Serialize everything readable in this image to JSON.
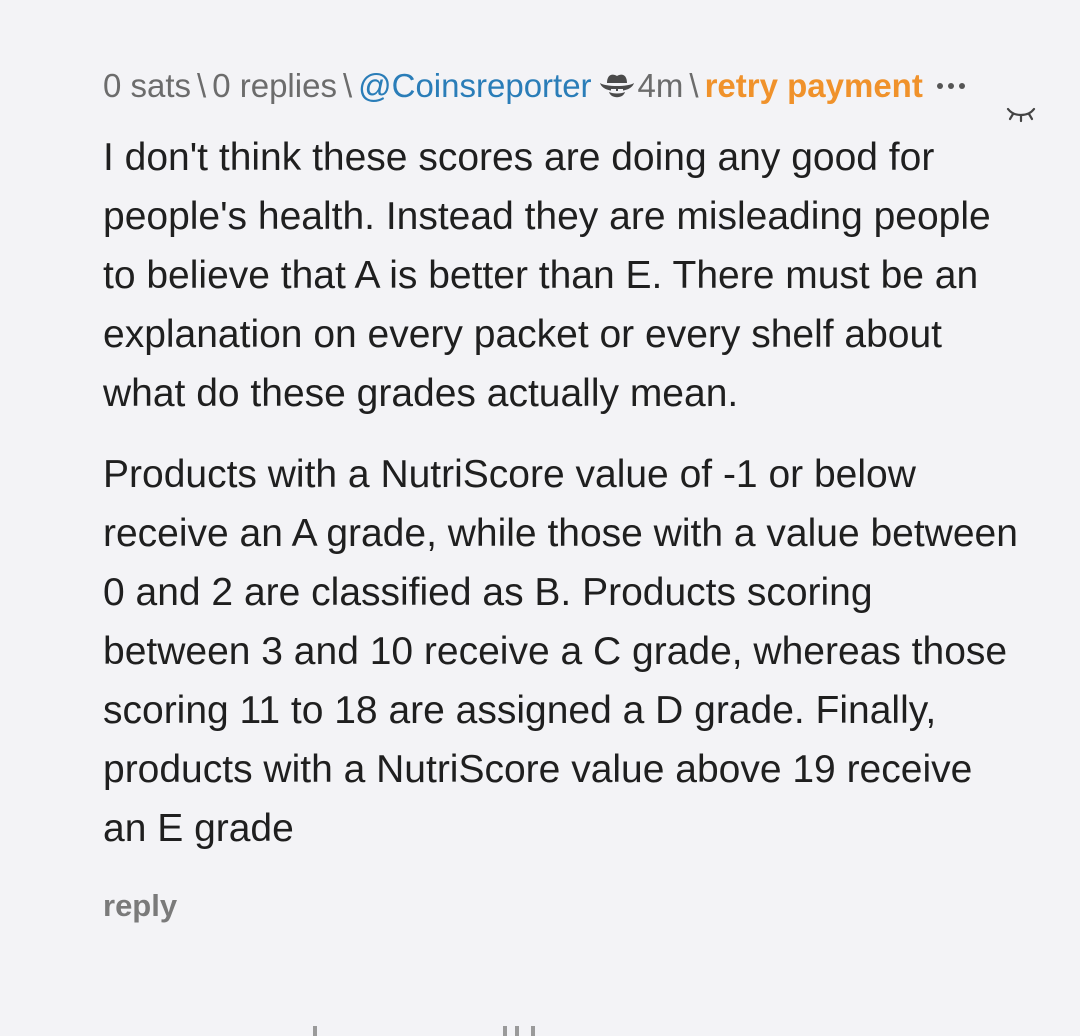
{
  "comment": {
    "sats": "0 sats",
    "replies": "0 replies",
    "separator": "\\",
    "author": "@Coinsreporter",
    "author_icon": "cowboy-hat-icon",
    "time": "4m",
    "retry_label": "retry payment",
    "more_icon": "ellipsis-icon",
    "collapse_icon": "eye-closed-icon",
    "paragraphs": [
      "I don't think these scores are doing any good for people's health. Instead they are misleading people to believe that A is better than E. There must be an explanation on every packet or every shelf about what do these grades actually mean.",
      "Products with a NutriScore value of -1 or below receive an A grade, while those with a value between 0 and 2 are classified as B. Products scoring between 3 and 10 receive a C grade, whereas those scoring 11 to 18 are assigned a D grade. Finally, products with a NutriScore value above 19 receive an E grade"
    ],
    "reply_label": "reply"
  },
  "colors": {
    "background": "#f3f3f6",
    "meta": "#6c6c6c",
    "author": "#2a7db8",
    "retry": "#f0922b",
    "body_text": "#1f1f1f",
    "reply": "#7a7a7a"
  }
}
